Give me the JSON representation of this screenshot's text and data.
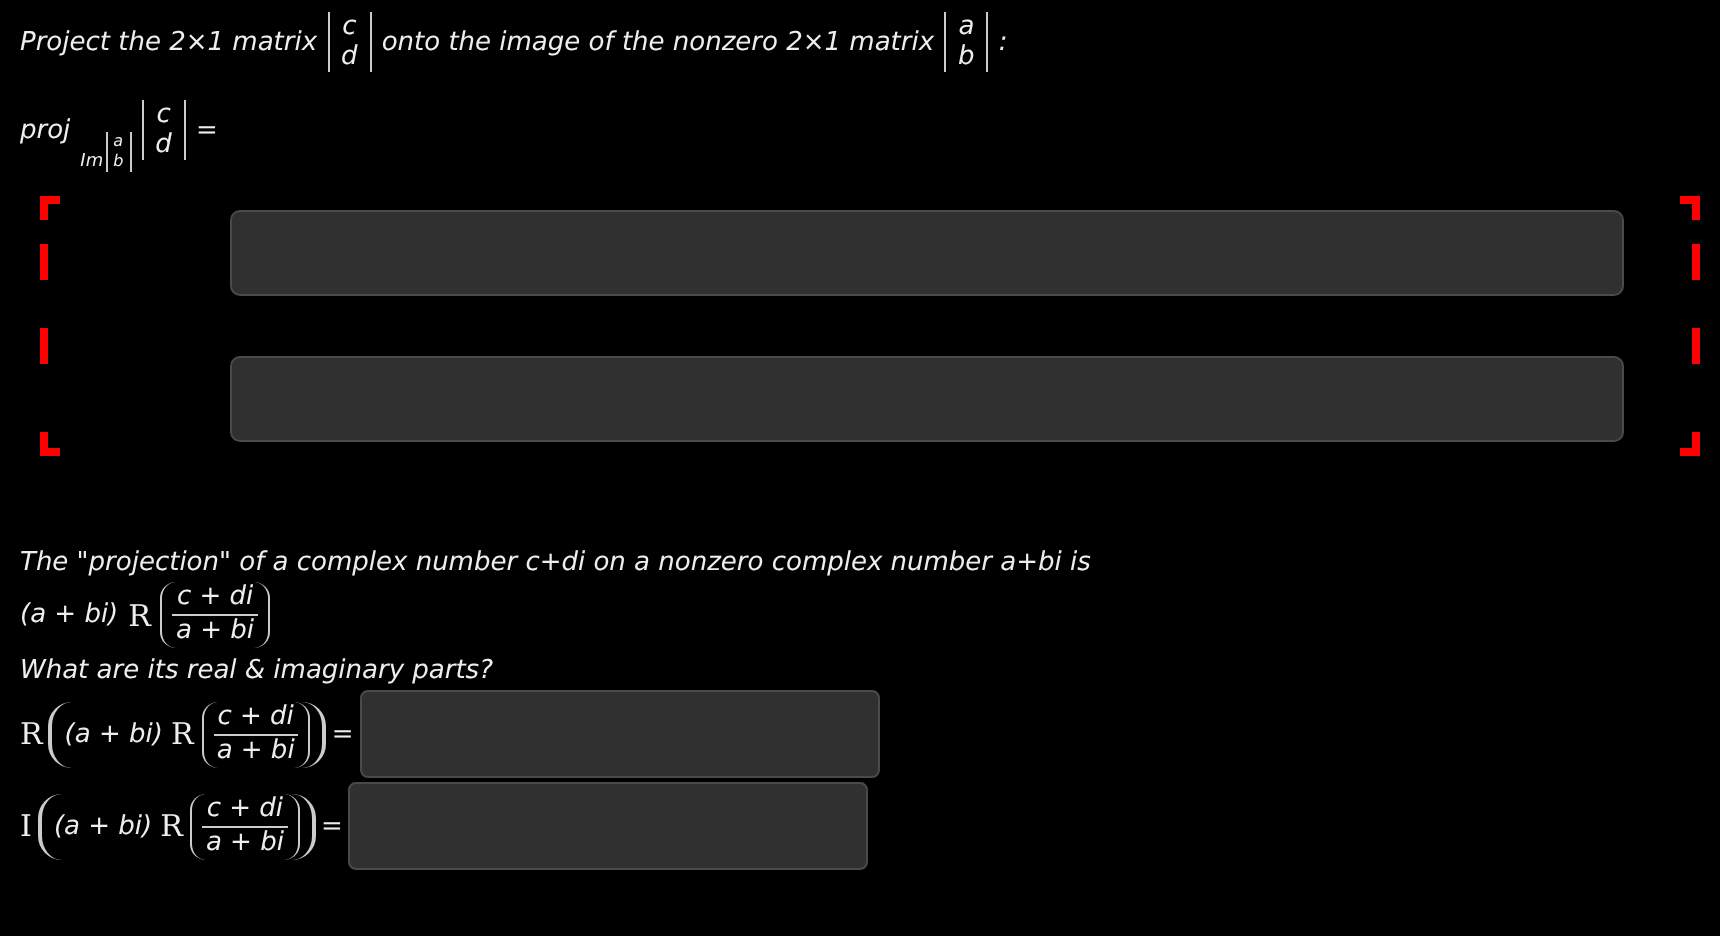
{
  "prompt": {
    "before": "Project the 2×1 matrix",
    "matrix_1": [
      "c",
      "d"
    ],
    "middle": "onto the image of the nonzero 2×1 matrix",
    "matrix_2": [
      "a",
      "b"
    ],
    "after": ":"
  },
  "lhs": {
    "operator": "proj",
    "subscript": "Im",
    "subscript_matrix": [
      "a",
      "b"
    ],
    "matrix": [
      "c",
      "d"
    ],
    "equals": "="
  },
  "answer_matrix": {
    "entries": [
      {
        "kind": "field"
      },
      {
        "kind": "field"
      }
    ]
  },
  "complex": {
    "intro": "The \"projection\" of a complex number c+di on a nonzero complex number a+bi is",
    "formula": {
      "factor": "(a + bi)",
      "operator": "R",
      "numerator": "c + di",
      "denominator": "a + bi"
    },
    "question": "What are its real & imaginary parts?",
    "parts": [
      {
        "operator": "R",
        "factor": "(a + bi)",
        "inner_operator": "R",
        "numerator": "c + di",
        "denominator": "a + bi",
        "equals": "="
      },
      {
        "operator": "I",
        "factor": "(a + bi)",
        "inner_operator": "R",
        "numerator": "c + di",
        "denominator": "a + bi",
        "equals": "="
      }
    ]
  }
}
